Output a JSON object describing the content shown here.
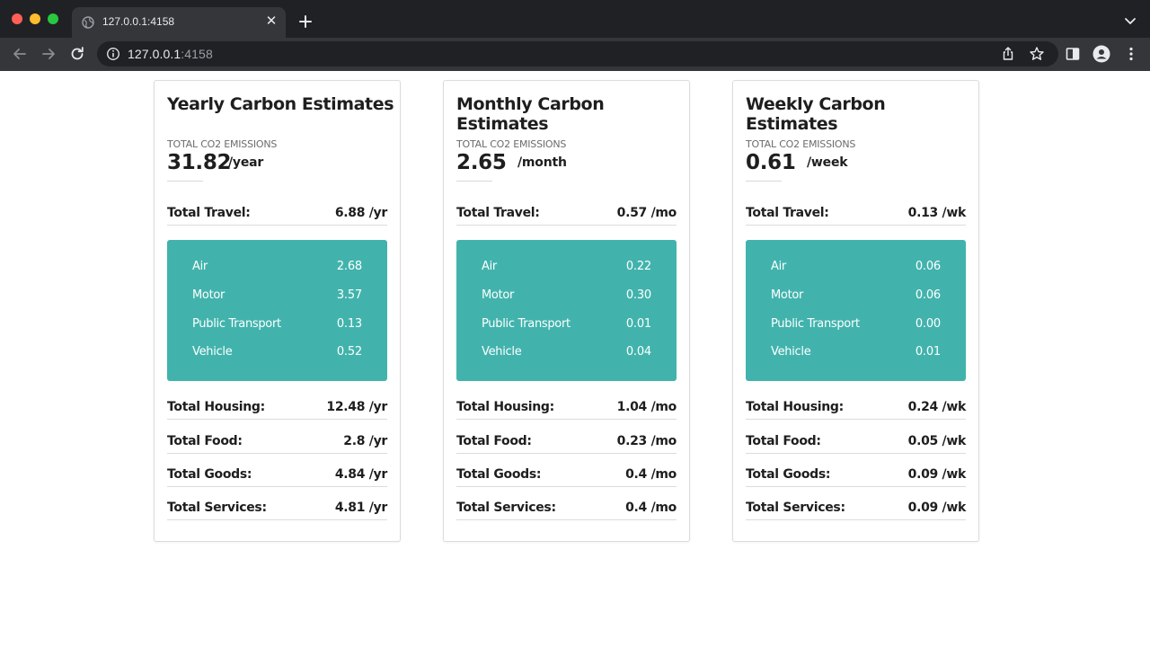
{
  "browser": {
    "tab_title": "127.0.0.1:4158",
    "url_host": "127.0.0.1",
    "url_port": ":4158",
    "icons": [
      "globe-icon",
      "close-icon",
      "plus-icon",
      "chevron-down-icon",
      "back-icon",
      "forward-icon",
      "reload-icon",
      "info-icon",
      "share-icon",
      "star-icon",
      "sidebar-icon",
      "profile-icon",
      "menu-icon"
    ]
  },
  "cards": [
    {
      "title": "Yearly Carbon Estimates",
      "total_label": "TOTAL CO2 EMISSIONS",
      "total_value": "31.82",
      "total_unit": "/year",
      "travel": {
        "label": "Total Travel:",
        "value": "6.88 /yr"
      },
      "travel_breakdown": [
        {
          "label": "Air",
          "value": "2.68"
        },
        {
          "label": "Motor",
          "value": "3.57"
        },
        {
          "label": "Public Transport",
          "value": "0.13"
        },
        {
          "label": "Vehicle",
          "value": "0.52"
        }
      ],
      "housing": {
        "label": "Total Housing:",
        "value": "12.48 /yr"
      },
      "food": {
        "label": "Total Food:",
        "value": "2.8 /yr"
      },
      "goods": {
        "label": "Total Goods:",
        "value": "4.84 /yr"
      },
      "services": {
        "label": "Total Services:",
        "value": "4.81 /yr"
      }
    },
    {
      "title": "Monthly Carbon Estimates",
      "total_label": "TOTAL CO2 EMISSIONS",
      "total_value": "2.65",
      "total_unit": "/month",
      "travel": {
        "label": "Total Travel:",
        "value": "0.57 /mo"
      },
      "travel_breakdown": [
        {
          "label": "Air",
          "value": "0.22"
        },
        {
          "label": "Motor",
          "value": "0.30"
        },
        {
          "label": "Public Transport",
          "value": "0.01"
        },
        {
          "label": "Vehicle",
          "value": "0.04"
        }
      ],
      "housing": {
        "label": "Total Housing:",
        "value": "1.04 /mo"
      },
      "food": {
        "label": "Total Food:",
        "value": "0.23 /mo"
      },
      "goods": {
        "label": "Total Goods:",
        "value": "0.4 /mo"
      },
      "services": {
        "label": "Total Services:",
        "value": "0.4 /mo"
      }
    },
    {
      "title": "Weekly Carbon Estimates",
      "total_label": "TOTAL CO2 EMISSIONS",
      "total_value": "0.61",
      "total_unit": "/week",
      "travel": {
        "label": "Total Travel:",
        "value": "0.13 /wk"
      },
      "travel_breakdown": [
        {
          "label": "Air",
          "value": "0.06"
        },
        {
          "label": "Motor",
          "value": "0.06"
        },
        {
          "label": "Public Transport",
          "value": "0.00"
        },
        {
          "label": "Vehicle",
          "value": "0.01"
        }
      ],
      "housing": {
        "label": "Total Housing:",
        "value": "0.24 /wk"
      },
      "food": {
        "label": "Total Food:",
        "value": "0.05 /wk"
      },
      "goods": {
        "label": "Total Goods:",
        "value": "0.09 /wk"
      },
      "services": {
        "label": "Total Services:",
        "value": "0.09 /wk"
      }
    }
  ],
  "colors": {
    "travel_box": "#41b3ac",
    "text": "#1e1e1e",
    "muted": "#6b6b6b"
  }
}
